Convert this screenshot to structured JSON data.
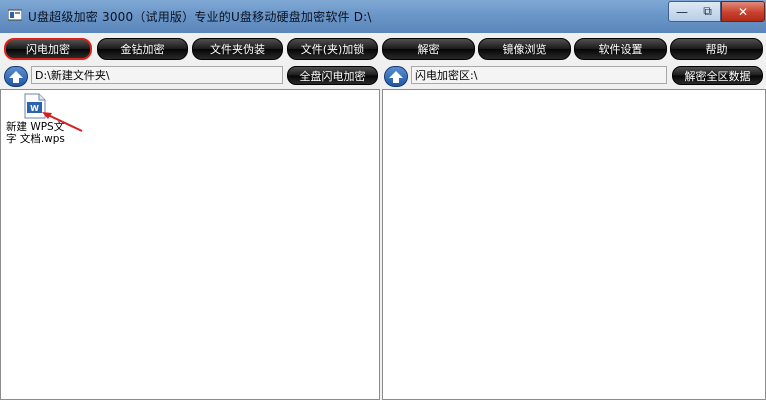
{
  "window": {
    "title": "U盘超级加密 3000（试用版）专业的U盘移动硬盘加密软件 D:\\",
    "controls": {
      "minimize": "—",
      "maximize": "⧉",
      "close": "✕"
    }
  },
  "toolbar": {
    "buttons": [
      {
        "label": "闪电加密",
        "active": true
      },
      {
        "label": "金钻加密"
      },
      {
        "label": "文件夹伪装"
      },
      {
        "label": "文件(夹)加锁"
      },
      {
        "label": "解密"
      },
      {
        "label": "镜像浏览"
      },
      {
        "label": "软件设置"
      },
      {
        "label": "帮助"
      }
    ]
  },
  "left_pane": {
    "path": "D:\\新建文件夹\\",
    "action_label": "全盘闪电加密",
    "files": [
      {
        "name": "新建 WPS文字 文档.wps",
        "icon": "wps-document-icon"
      }
    ]
  },
  "right_pane": {
    "path": "闪电加密区:\\",
    "action_label": "解密全区数据",
    "files": []
  },
  "colors": {
    "titlebar": "#6b96c8",
    "toolbar_button": "#1a1a1a",
    "active_border": "#d8231b",
    "up_button": "#1f55a6"
  }
}
